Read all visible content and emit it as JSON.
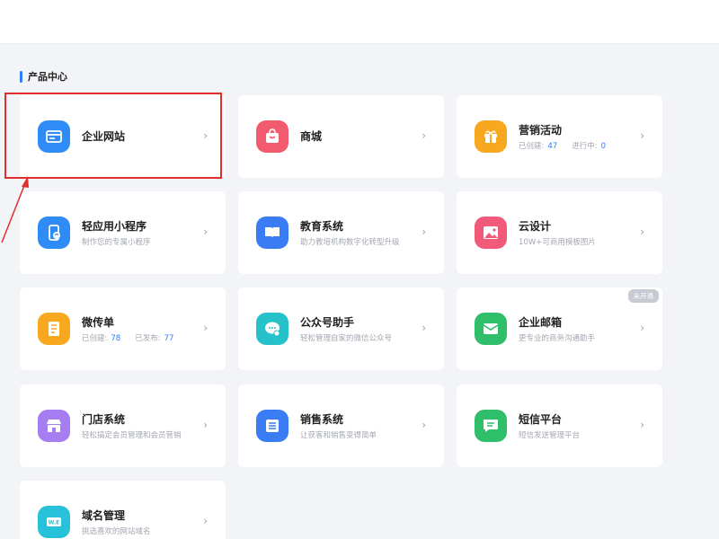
{
  "section": {
    "title": "产品中心"
  },
  "cards": [
    {
      "name": "card-enterprise-website",
      "title": "企业网站",
      "icon": "website-icon",
      "color": "#2f8cf7"
    },
    {
      "name": "card-mall",
      "title": "商城",
      "icon": "shopping-bag-icon",
      "color": "#f25a6e"
    },
    {
      "name": "card-marketing",
      "title": "营销活动",
      "icon": "gift-icon",
      "color": "#f7a81e",
      "stats": [
        {
          "label": "已创建:",
          "value": "47"
        },
        {
          "label": "进行中:",
          "value": "0"
        }
      ]
    },
    {
      "name": "card-mini-program",
      "title": "轻应用小程序",
      "desc": "制作您的专属小程序",
      "icon": "mini-program-icon",
      "color": "#2f8cf7"
    },
    {
      "name": "card-education",
      "title": "教育系统",
      "desc": "助力教培机构数字化转型升级",
      "icon": "book-icon",
      "color": "#3a7cf4"
    },
    {
      "name": "card-cloud-design",
      "title": "云设计",
      "desc": "10W+可商用模板图片",
      "icon": "image-icon",
      "color": "#f25a7a"
    },
    {
      "name": "card-micro-leaflet",
      "title": "微传单",
      "icon": "leaflet-icon",
      "color": "#f7a81e",
      "stats": [
        {
          "label": "已创建:",
          "value": "78"
        },
        {
          "label": "已发布:",
          "value": "77"
        }
      ]
    },
    {
      "name": "card-official-account",
      "title": "公众号助手",
      "desc": "轻松管理自家的微信公众号",
      "icon": "chat-gear-icon",
      "color": "#27c2c9"
    },
    {
      "name": "card-enterprise-mail",
      "title": "企业邮箱",
      "desc": "更专业的商务沟通助手",
      "icon": "mail-icon",
      "color": "#2fbf6b",
      "badge": "未开通"
    },
    {
      "name": "card-store-system",
      "title": "门店系统",
      "desc": "轻松搞定会员管理和会员营销",
      "icon": "store-icon",
      "color": "#a77ef2"
    },
    {
      "name": "card-sales-system",
      "title": "销售系统",
      "desc": "让获客和销售变得简单",
      "icon": "list-icon",
      "color": "#3a7cf4"
    },
    {
      "name": "card-sms-platform",
      "title": "短信平台",
      "desc": "短信发送管理平台",
      "icon": "message-icon",
      "color": "#2fbf6b"
    },
    {
      "name": "card-domain-management",
      "title": "域名管理",
      "desc": "挑选喜欢的网站域名",
      "icon": "domain-icon",
      "color": "#27c2d9"
    }
  ],
  "chevron": "›"
}
